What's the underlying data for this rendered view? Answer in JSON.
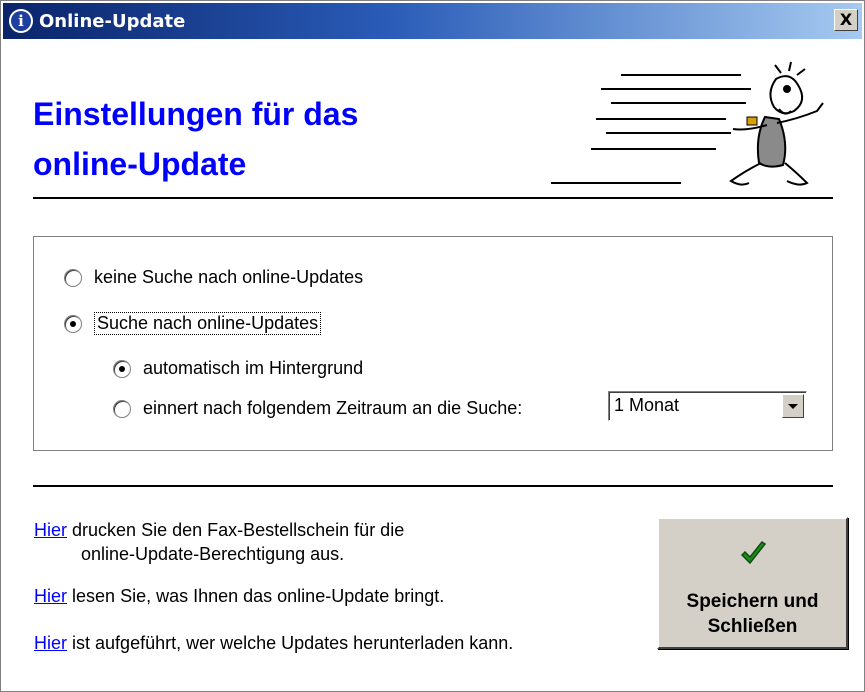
{
  "window": {
    "title": "Online-Update",
    "close_label": "X",
    "title_icon": "i"
  },
  "heading": {
    "line1": "Einstellungen für das",
    "line2": "online-Update"
  },
  "options": {
    "no_search": {
      "label": "keine Suche nach online-Updates",
      "checked": false
    },
    "search": {
      "label": "Suche nach online-Updates",
      "checked": true
    },
    "automatic": {
      "label": "automatisch im Hintergrund",
      "checked": true
    },
    "remind": {
      "label": "einnert nach folgendem Zeitraum an die Suche:",
      "checked": false
    }
  },
  "interval_select": {
    "value": "1 Monat"
  },
  "links": [
    {
      "link": "Hier",
      "text_line1": "drucken Sie den Fax-Bestellschein für die",
      "text_line2": "online-Update-Berechtigung aus."
    },
    {
      "link": "Hier",
      "text_line1": "lesen Sie, was Ihnen das online-Update bringt."
    },
    {
      "link": "Hier",
      "text_line1": "ist aufgeführt, wer welche Updates herunterladen kann."
    }
  ],
  "save_button": {
    "line1": "Speichern und",
    "line2": "Schließen"
  },
  "colors": {
    "heading": "#0000ff",
    "link": "#0000ff",
    "titlebar_start": "#0a246a",
    "titlebar_end": "#a6caf0",
    "check_icon": "#1e8a1e"
  },
  "icons": {
    "title_icon": "info-icon",
    "close": "close-icon",
    "save": "checkmark-icon",
    "illustration": "running-man-illustration",
    "dropdown": "chevron-down-icon"
  }
}
